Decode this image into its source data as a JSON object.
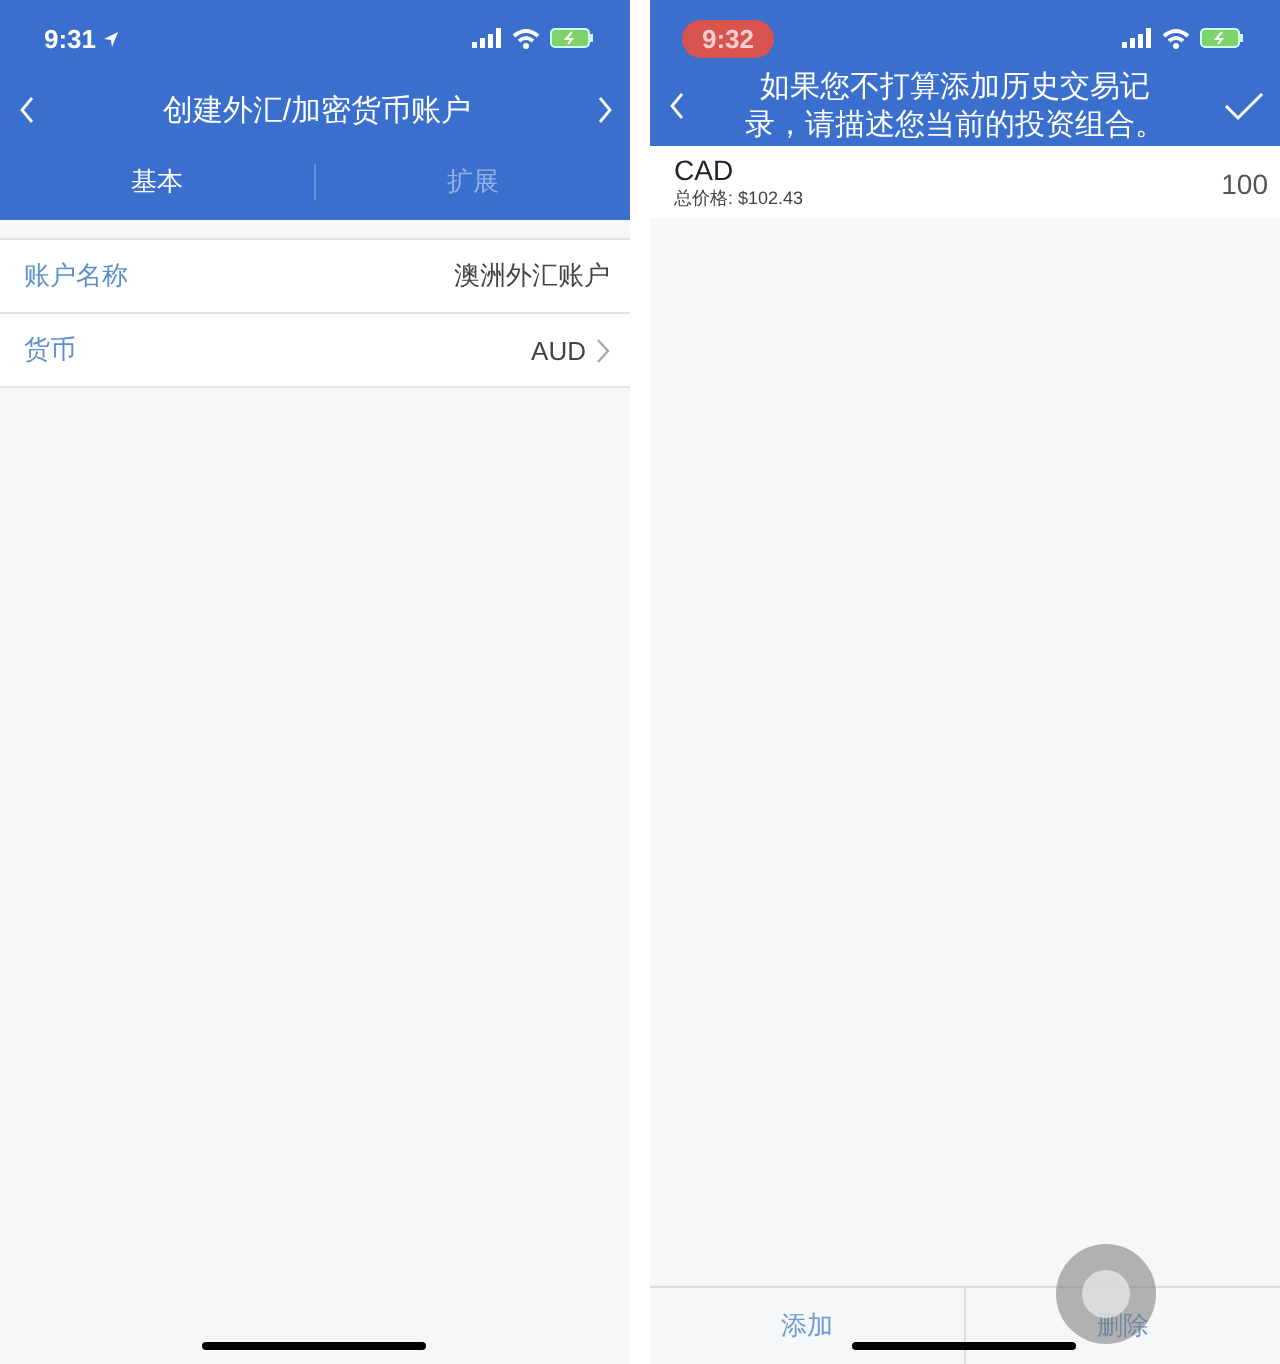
{
  "left_screen": {
    "status_bar": {
      "time": "9:31",
      "recording": false,
      "location": true
    },
    "nav": {
      "title": "创建外汇/加密货币账户"
    },
    "tabs": [
      {
        "label": "基本",
        "selected": true
      },
      {
        "label": "扩展",
        "selected": false
      }
    ],
    "fields": [
      {
        "label": "账户名称",
        "value": "澳洲外汇账户",
        "kind": "text"
      },
      {
        "label": "货币",
        "value": "AUD",
        "kind": "picker"
      }
    ]
  },
  "right_screen": {
    "status_bar": {
      "time": "9:32",
      "recording": true,
      "location": false
    },
    "nav": {
      "title": "如果您不打算添加历史交易记录，请描述您当前的投资组合。"
    },
    "holdings": [
      {
        "name": "CAD",
        "total": "总价格: $102.43",
        "quantity": "100"
      }
    ],
    "toolbar": [
      {
        "label": "添加"
      },
      {
        "label": "删除"
      }
    ]
  }
}
